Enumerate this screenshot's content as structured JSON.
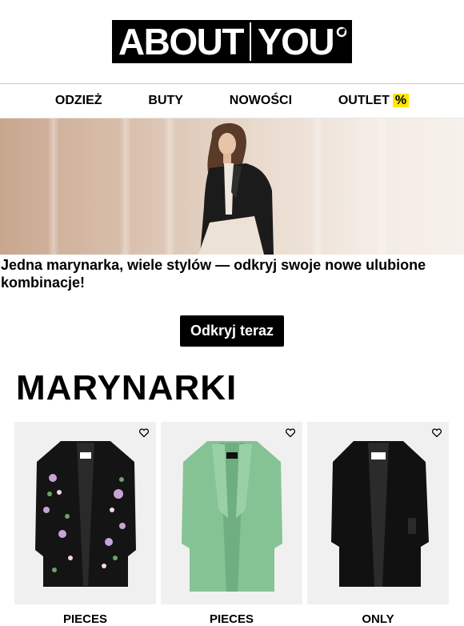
{
  "header": {
    "logo_text_left": "ABOUT",
    "logo_text_right": "YOU"
  },
  "nav": {
    "items": [
      "ODZIEŻ",
      "BUTY",
      "NOWOŚCI",
      "OUTLET"
    ],
    "outlet_badge": "%"
  },
  "promo": {
    "text": "Jedna marynarka, wiele stylów — odkryj swoje nowe ulubione kombinacje!",
    "cta_label": "Odkryj teraz"
  },
  "section": {
    "title": "MARYNARKI"
  },
  "products": [
    {
      "brand": "PIECES",
      "color": "floral black",
      "icon": "heart-icon"
    },
    {
      "brand": "PIECES",
      "color": "#86c394",
      "icon": "heart-icon"
    },
    {
      "brand": "ONLY",
      "color": "#111111",
      "icon": "heart-icon"
    }
  ],
  "colors": {
    "accent": "#ffe600",
    "brand": "#000000"
  }
}
